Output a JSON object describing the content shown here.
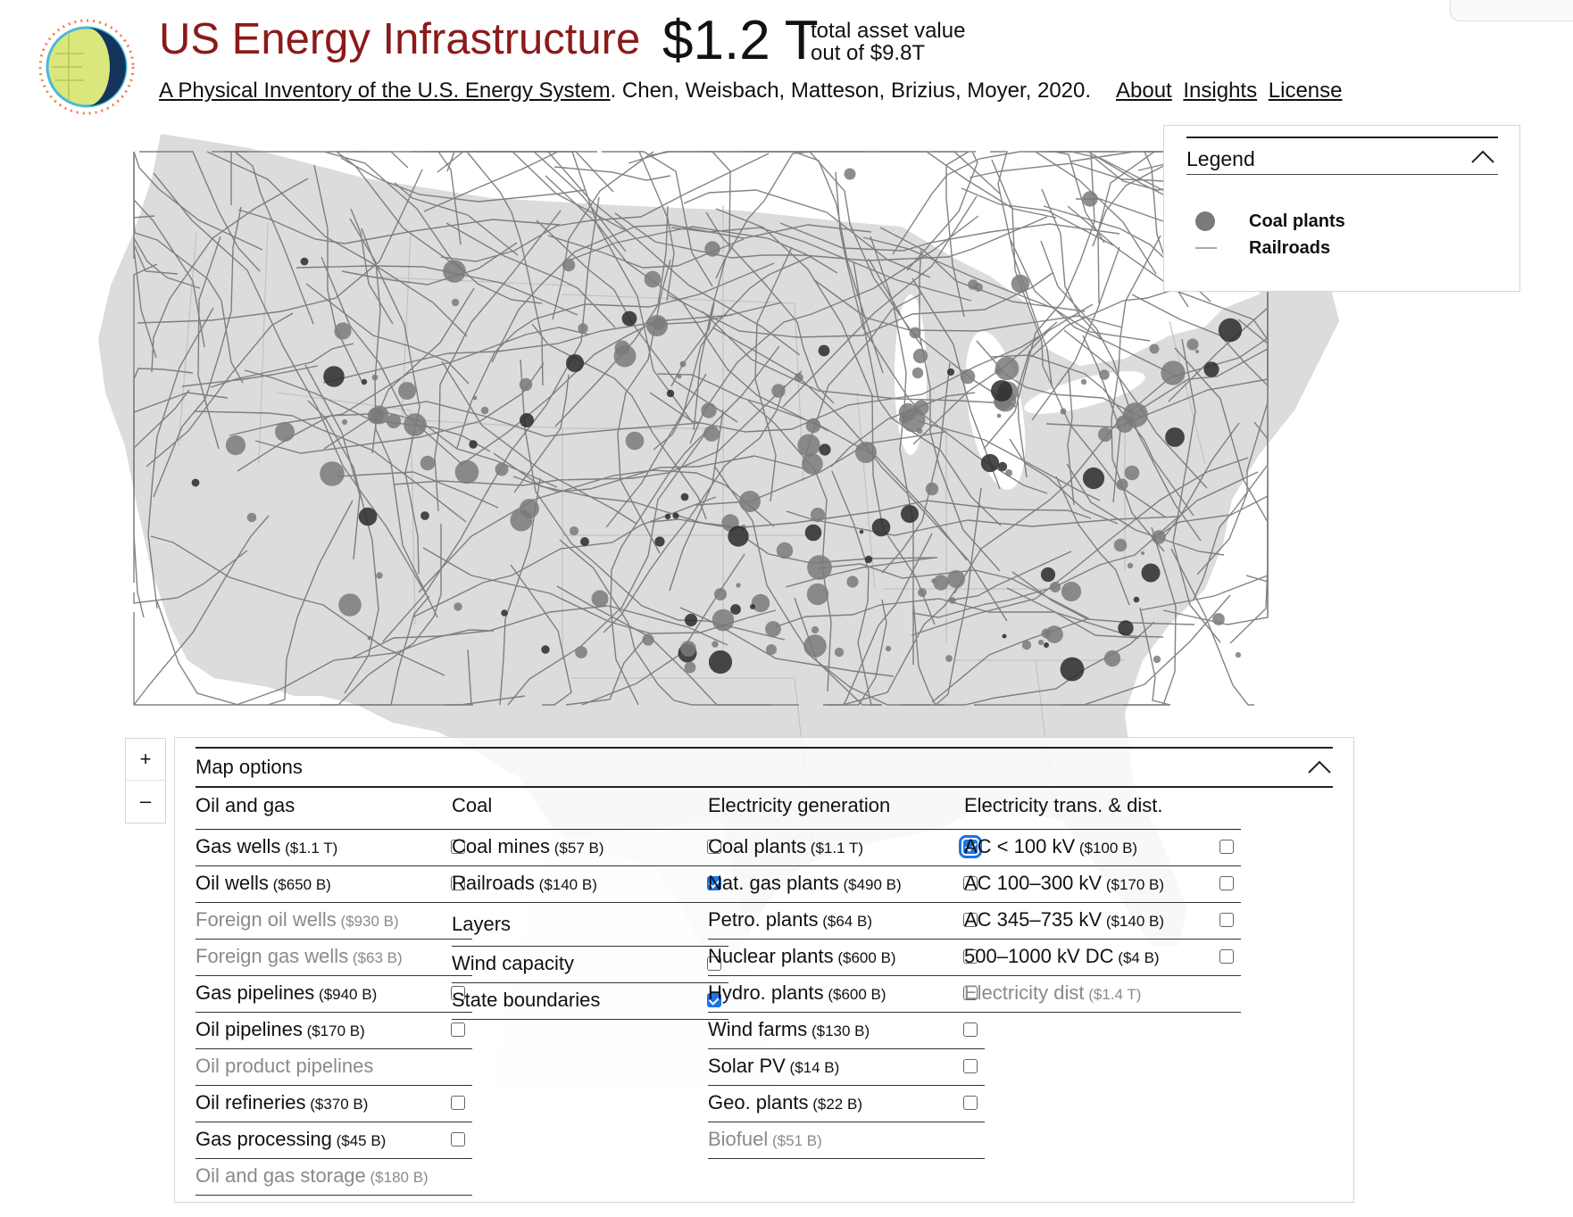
{
  "header": {
    "title": "US Energy Infrastructure",
    "value": "$1.2 T",
    "value_label_1": "total asset value",
    "value_label_2": "out of $9.8T",
    "paper_link": "A Physical Inventory of the U.S. Energy System",
    "authors": ". Chen, Weisbach, Matteson, Brizius, Moyer, 2020.",
    "nav": {
      "about": "About",
      "insights": "Insights",
      "license": "License"
    }
  },
  "colors": {
    "title": "#8b1a1a",
    "land": "#dcdcdc",
    "rail": "#6e6e6e",
    "plant": "#7a7a7a",
    "checkbox_checked": "#1a73e8"
  },
  "legend": {
    "title": "Legend",
    "expanded": true,
    "items": [
      {
        "label": "Coal plants",
        "symbol": "circle"
      },
      {
        "label": "Railroads",
        "symbol": "line"
      }
    ]
  },
  "zoom": {
    "in": "+",
    "out": "–"
  },
  "map_options": {
    "title": "Map options",
    "columns": [
      {
        "title": "Oil and gas",
        "items": [
          {
            "name": "Gas wells",
            "value": "($1.1 T)",
            "checked": false,
            "enabled": true
          },
          {
            "name": "Oil wells",
            "value": "($650 B)",
            "checked": false,
            "enabled": true
          },
          {
            "name": "Foreign oil wells",
            "value": "($930 B)",
            "enabled": false
          },
          {
            "name": "Foreign gas wells",
            "value": "($63 B)",
            "enabled": false
          },
          {
            "name": "Gas pipelines",
            "value": "($940 B)",
            "checked": false,
            "enabled": true
          },
          {
            "name": "Oil pipelines",
            "value": "($170 B)",
            "checked": false,
            "enabled": true
          },
          {
            "name": "Oil product pipelines",
            "value": "",
            "enabled": false
          },
          {
            "name": "Oil refineries",
            "value": "($370 B)",
            "checked": false,
            "enabled": true
          },
          {
            "name": "Gas processing",
            "value": "($45 B)",
            "checked": false,
            "enabled": true
          },
          {
            "name": "Oil and gas storage",
            "value": "($180 B)",
            "enabled": false
          }
        ]
      },
      {
        "title": "Coal",
        "items": [
          {
            "name": "Coal mines",
            "value": "($57 B)",
            "checked": false,
            "enabled": true
          },
          {
            "name": "Railroads",
            "value": "($140 B)",
            "checked": true,
            "enabled": true
          },
          {
            "name": "Layers",
            "section": true
          },
          {
            "name": "Wind capacity",
            "value": "",
            "checked": false,
            "enabled": true
          },
          {
            "name": "State boundaries",
            "value": "",
            "checked": true,
            "enabled": true
          }
        ]
      },
      {
        "title": "Electricity generation",
        "items": [
          {
            "name": "Coal plants",
            "value": "($1.1 T)",
            "checked": true,
            "enabled": true,
            "focused": true
          },
          {
            "name": "Nat. gas plants",
            "value": "($490 B)",
            "checked": false,
            "enabled": true
          },
          {
            "name": "Petro. plants",
            "value": "($64 B)",
            "checked": false,
            "enabled": true
          },
          {
            "name": "Nuclear plants",
            "value": "($600 B)",
            "checked": false,
            "enabled": true
          },
          {
            "name": "Hydro. plants",
            "value": "($600 B)",
            "checked": false,
            "enabled": true
          },
          {
            "name": "Wind farms",
            "value": "($130 B)",
            "checked": false,
            "enabled": true
          },
          {
            "name": "Solar PV",
            "value": "($14 B)",
            "checked": false,
            "enabled": true
          },
          {
            "name": "Geo. plants",
            "value": "($22 B)",
            "checked": false,
            "enabled": true
          },
          {
            "name": "Biofuel",
            "value": "($51 B)",
            "enabled": false
          }
        ]
      },
      {
        "title": "Electricity trans. & dist.",
        "items": [
          {
            "name": "AC < 100 kV",
            "value": "($100 B)",
            "checked": false,
            "enabled": true
          },
          {
            "name": "AC 100–300 kV",
            "value": "($170 B)",
            "checked": false,
            "enabled": true
          },
          {
            "name": "AC 345–735 kV",
            "value": "($140 B)",
            "checked": false,
            "enabled": true
          },
          {
            "name": "500–1000 kV DC",
            "value": "($4 B)",
            "checked": false,
            "enabled": true
          },
          {
            "name": "Electricity dist",
            "value": "($1.4 T)",
            "enabled": false
          }
        ]
      }
    ]
  }
}
